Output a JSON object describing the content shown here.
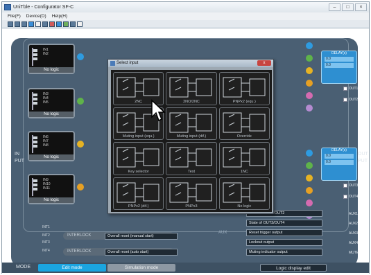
{
  "window": {
    "title": "UniTble - Configurator SF-C"
  },
  "menu": [
    "File(F)",
    "Device(D)",
    "Help(H)"
  ],
  "toolbar_icons": [
    "new-icon",
    "open-icon",
    "save-icon",
    "print-icon",
    "cut-icon",
    "copy-icon",
    "paste-icon",
    "settings-icon",
    "info-icon",
    "stop-icon",
    "monitor-icon"
  ],
  "inputs": [
    {
      "label": "No logic",
      "pins": [
        "IN1",
        "IN2"
      ]
    },
    {
      "label": "No logic",
      "pins": [
        "IN3",
        "IN4",
        "IN5"
      ]
    },
    {
      "label": "No logic",
      "pins": [
        "IN6",
        "IN7",
        "IN8"
      ]
    },
    {
      "label": "No logic",
      "pins": [
        "IN9",
        "IN10",
        "IN11"
      ]
    }
  ],
  "side_labels": {
    "in": "IN",
    "out": "OUT",
    "in2": "PUT",
    "out2": "PUT"
  },
  "outputs": [
    {
      "title": "DELAY(s)",
      "rows": [
        "0.0",
        "0.0"
      ],
      "labels": [
        "OUT1",
        "OUT2"
      ]
    },
    {
      "title": "DELAY(s)",
      "rows": [
        "0.0",
        "0.0"
      ],
      "labels": [
        "OUT3",
        "OUT4"
      ]
    }
  ],
  "aux": {
    "title": "AUX",
    "labels": [
      "AUX1",
      "AUX2",
      "AUX3",
      "AUX4",
      "MUTE"
    ]
  },
  "aux_fields": [
    "State of OUT1/OUT2",
    "State of OUT3/OUT4",
    "Reset trigger output",
    "Lockout output",
    "Muting indicator output"
  ],
  "interlock": {
    "label": "INTERLOCK",
    "rows": [
      {
        "value": "Overall reset (manual start)",
        "pins": [
          "INT1",
          "INT2"
        ]
      },
      {
        "value": "Overall reset (auto start)",
        "pins": [
          "INT3",
          "INT4"
        ]
      }
    ]
  },
  "mode": {
    "label": "MODE",
    "edit": "Edit mode",
    "sim": "Simulation mode",
    "logic": "Logic display edit"
  },
  "dialog": {
    "title": "Select input",
    "close": "x",
    "tiles": [
      "2NC",
      "2NO/2NC",
      "PNPx2 (equ.)",
      "Muting input (equ.)",
      "Muting input (dif.)",
      "Override",
      "Key selector",
      "Test",
      "1NC",
      "PNPx2 (dif.)",
      "PNPx3",
      "No logic"
    ]
  },
  "colors": {
    "board": "#4a5f73",
    "accent": "#2e8fd1",
    "edit_mode": "#1ba5e0"
  }
}
